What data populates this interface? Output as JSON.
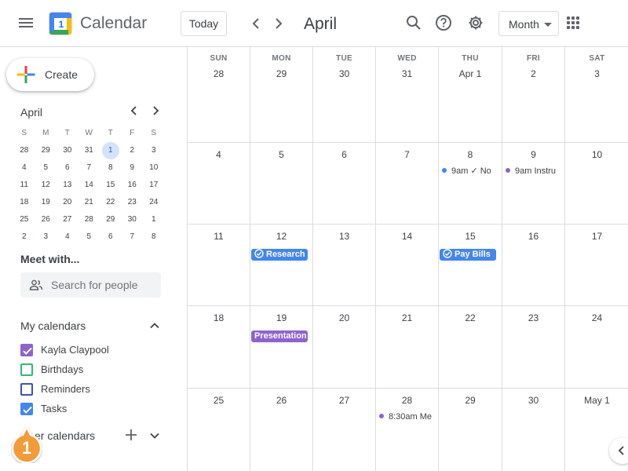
{
  "header": {
    "app_title": "Calendar",
    "logo_day": "1",
    "today_label": "Today",
    "month_title": "April",
    "view_label": "Month"
  },
  "sidebar": {
    "create_label": "Create",
    "mini": {
      "title": "April",
      "dow": [
        "S",
        "M",
        "T",
        "W",
        "T",
        "F",
        "S"
      ],
      "weeks": [
        [
          "28",
          "29",
          "30",
          "31",
          "1",
          "2",
          "3"
        ],
        [
          "4",
          "5",
          "6",
          "7",
          "8",
          "9",
          "10"
        ],
        [
          "11",
          "12",
          "13",
          "14",
          "15",
          "16",
          "17"
        ],
        [
          "18",
          "19",
          "20",
          "21",
          "22",
          "23",
          "24"
        ],
        [
          "25",
          "26",
          "27",
          "28",
          "29",
          "30",
          "1"
        ],
        [
          "2",
          "3",
          "4",
          "5",
          "6",
          "7",
          "8"
        ]
      ],
      "today": "1"
    },
    "meet_title": "Meet with...",
    "search_placeholder": "Search for people",
    "my_calendars_title": "My calendars",
    "calendars": [
      {
        "name": "Kayla Claypool",
        "color": "#8e63ce",
        "checked": true
      },
      {
        "name": "Birthdays",
        "color": "#33b679",
        "checked": false
      },
      {
        "name": "Reminders",
        "color": "#3f51b5",
        "checked": false
      },
      {
        "name": "Tasks",
        "color": "#4285f4",
        "checked": true
      }
    ],
    "other_calendars_title": "er calendars",
    "callout_number": "1"
  },
  "grid": {
    "dow": [
      "SUN",
      "MON",
      "TUE",
      "WED",
      "THU",
      "FRI",
      "SAT"
    ],
    "weeks": [
      [
        "28",
        "29",
        "30",
        "31",
        "Apr 1",
        "2",
        "3"
      ],
      [
        "4",
        "5",
        "6",
        "7",
        "8",
        "9",
        "10"
      ],
      [
        "11",
        "12",
        "13",
        "14",
        "15",
        "16",
        "17"
      ],
      [
        "18",
        "19",
        "20",
        "21",
        "22",
        "23",
        "24"
      ],
      [
        "25",
        "26",
        "27",
        "28",
        "29",
        "30",
        "May 1"
      ]
    ],
    "events": [
      {
        "week": 1,
        "day": 4,
        "style": "dot",
        "text": "9am ✓ No",
        "color": "#4285f4"
      },
      {
        "week": 1,
        "day": 5,
        "style": "dot",
        "text": "9am Instru",
        "color": "#8e63ce"
      },
      {
        "week": 2,
        "day": 1,
        "style": "chip",
        "text": "Research",
        "task": true,
        "color": "#4285f4"
      },
      {
        "week": 2,
        "day": 4,
        "style": "chip",
        "text": "Pay Bills",
        "task": true,
        "color": "#4285f4"
      },
      {
        "week": 3,
        "day": 1,
        "style": "chip",
        "text": "Presentation",
        "task": false,
        "color": "#8e63ce"
      },
      {
        "week": 4,
        "day": 3,
        "style": "dot",
        "text": "8:30am Me",
        "color": "#8e63ce"
      }
    ]
  }
}
